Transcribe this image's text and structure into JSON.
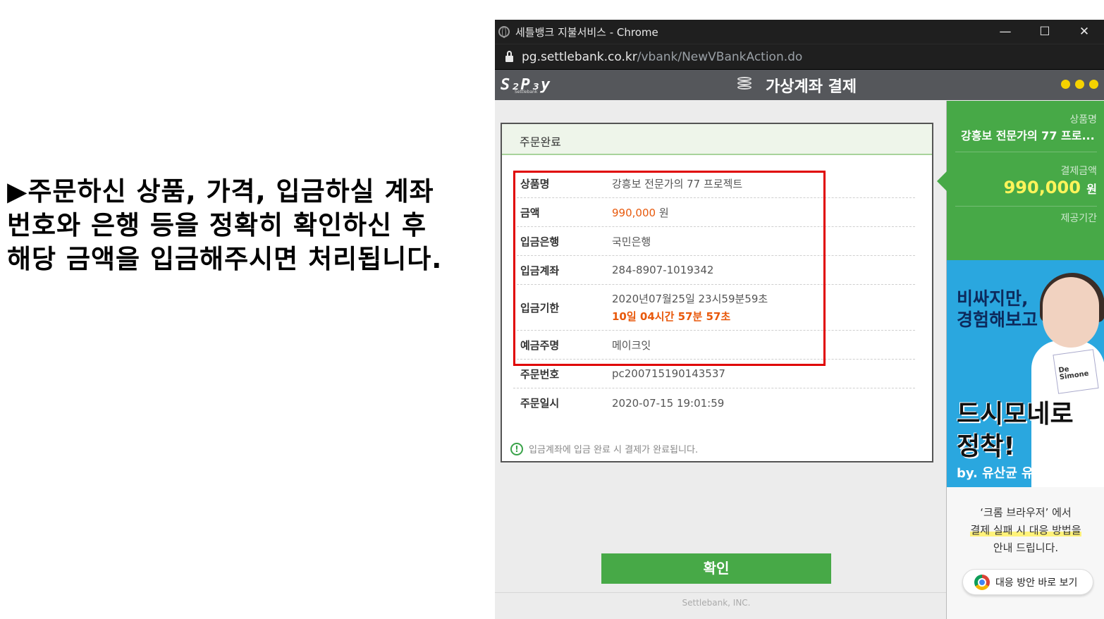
{
  "instruction": {
    "lines": [
      "▶주문하신 상품, 가격, 입금하실 계좌",
      "번호와 은행 등을 정확히 확인하신 후",
      "해당 금액을 입금해주시면 처리됩니다."
    ]
  },
  "browser": {
    "window_title": "세틀뱅크 지불서비스 - Chrome",
    "url_host": "pg.settlebank.co.kr",
    "url_path": "/vbank/NewVBankAction.do",
    "controls": {
      "minimize": "—",
      "maximize": "☐",
      "close": "✕"
    }
  },
  "app": {
    "logo": "S₂P₃y",
    "logo_sub": "Settlebank",
    "title": "가상계좌 결제",
    "dots_color": "#f5d200"
  },
  "order": {
    "header": "주문완료",
    "rows": [
      {
        "label": "상품명",
        "value": "강흥보 전문가의 77 프로젝트"
      },
      {
        "label": "금액",
        "value": "990,000",
        "unit": "원"
      },
      {
        "label": "입금은행",
        "value": "국민은행"
      },
      {
        "label": "입금계좌",
        "value": "284-8907-1019342"
      },
      {
        "label": "입금기한",
        "value": "2020년07월25일 23시59분59초",
        "countdown": "10일 04시간 57분 57초"
      },
      {
        "label": "예금주명",
        "value": "메이크잇"
      },
      {
        "label": "주문번호",
        "value": "pc200715190143537"
      },
      {
        "label": "주문일시",
        "value": "2020-07-15 19:01:59"
      }
    ],
    "notice": "입금계좌에 입금 완료 시 결제가 완료됩니다.",
    "confirm_label": "확인",
    "footer": "Settlebank, INC."
  },
  "sidebar": {
    "product_label": "상품명",
    "product_name": "강흥보 전문가의 77 프로...",
    "amount_label": "결제금액",
    "amount": "990,000",
    "amount_unit": "원",
    "period_label": "제공기간",
    "ad": {
      "line1": "비싸지만,",
      "line2": "경험해보고",
      "line3": "드시모네로",
      "line4": "정착!",
      "line5": "by. 유산균 유목민",
      "box_text": "De Simone"
    },
    "guide_line1": "‘크롬 브라우저’ 에서",
    "guide_line2": "결제 실패 시 대응 방법을",
    "guide_line3": "안내 드립니다.",
    "chrome_button": "대응 방안 바로 보기"
  },
  "colors": {
    "accent_green": "#47a947",
    "price_orange": "#e8590c",
    "highlight_red": "#e00000"
  }
}
